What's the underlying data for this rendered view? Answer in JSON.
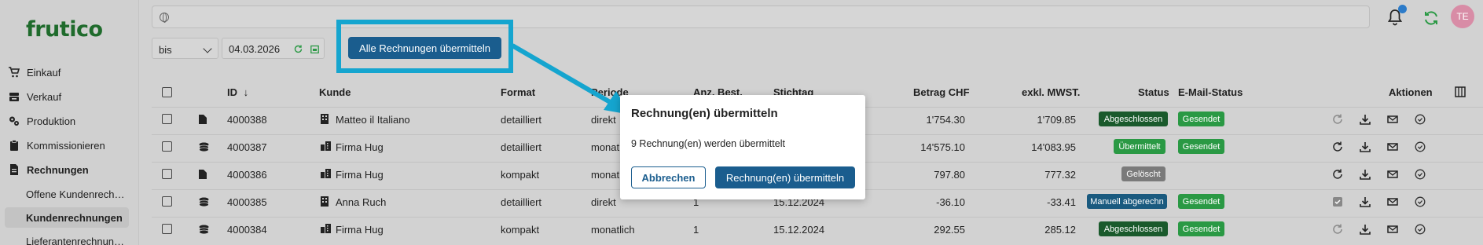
{
  "brand": {
    "logo": "frutico"
  },
  "sidebar": {
    "items": [
      {
        "label": "Einkauf",
        "icon": "cart-icon"
      },
      {
        "label": "Verkauf",
        "icon": "register-icon"
      },
      {
        "label": "Produktion",
        "icon": "gears-icon"
      },
      {
        "label": "Kommissionieren",
        "icon": "clipboard-icon"
      },
      {
        "label": "Rechnungen",
        "icon": "invoice-icon"
      }
    ],
    "sub_items": [
      "Offene Kundenrech…",
      "Kundenrechnungen",
      "Lieferantenrechnun…"
    ]
  },
  "header": {
    "search_placeholder": "",
    "avatar_initials": "TE"
  },
  "filters": {
    "mode": "bis",
    "date": "04.03.2026"
  },
  "toolbar": {
    "send_all_label": "Alle Rechnungen übermitteln"
  },
  "table": {
    "columns": {
      "id": "ID",
      "kunde": "Kunde",
      "format": "Format",
      "periode": "Periode",
      "anz": "Anz. Best.",
      "stichtag": "Stichtag",
      "betrag": "Betrag CHF",
      "exkl": "exkl. MWST.",
      "status": "Status",
      "email": "E-Mail-Status",
      "aktionen": "Aktionen"
    },
    "rows": [
      {
        "id": "4000388",
        "kunde": "Matteo il Italiano",
        "format": "detailliert",
        "periode": "direkt",
        "anz": "",
        "stichtag": "",
        "betrag": "1'754.30",
        "exkl": "1'709.85",
        "status": "Abgeschlossen",
        "status_kind": "dark",
        "email": "Gesendet",
        "doc_icon": "document-icon",
        "cust_icon": "building-icon"
      },
      {
        "id": "4000387",
        "kunde": "Firma Hug",
        "format": "detailliert",
        "periode": "monat",
        "anz": "",
        "stichtag": "",
        "betrag": "14'575.10",
        "exkl": "14'083.95",
        "status": "Übermittelt",
        "status_kind": "green",
        "email": "Gesendet",
        "doc_icon": "stack-icon",
        "cust_icon": "company-icon"
      },
      {
        "id": "4000386",
        "kunde": "Firma Hug",
        "format": "kompakt",
        "periode": "monat",
        "anz": "",
        "stichtag": "",
        "betrag": "797.80",
        "exkl": "777.32",
        "status": "Gelöscht",
        "status_kind": "grey",
        "email": "",
        "doc_icon": "document-icon",
        "cust_icon": "company-icon"
      },
      {
        "id": "4000385",
        "kunde": "Anna Ruch",
        "format": "detailliert",
        "periode": "direkt",
        "anz": "1",
        "stichtag": "15.12.2024",
        "betrag": "-36.10",
        "exkl": "-33.41",
        "status": "Manuell abgerechn",
        "status_kind": "blue",
        "email": "Gesendet",
        "doc_icon": "stack-icon",
        "cust_icon": "building-icon"
      },
      {
        "id": "4000384",
        "kunde": "Firma Hug",
        "format": "kompakt",
        "periode": "monatlich",
        "anz": "1",
        "stichtag": "15.12.2024",
        "betrag": "292.55",
        "exkl": "285.12",
        "status": "Abgeschlossen",
        "status_kind": "dark",
        "email": "Gesendet",
        "doc_icon": "stack-icon",
        "cust_icon": "company-icon"
      }
    ]
  },
  "modal": {
    "title": "Rechnung(en) übermitteln",
    "text": "9 Rechnung(en) werden übermittelt",
    "cancel": "Abbrechen",
    "confirm": "Rechnung(en) übermitteln"
  },
  "colors": {
    "accent": "#1a5d8e",
    "highlight": "#15a5cf",
    "brand": "#1f6b2c"
  }
}
